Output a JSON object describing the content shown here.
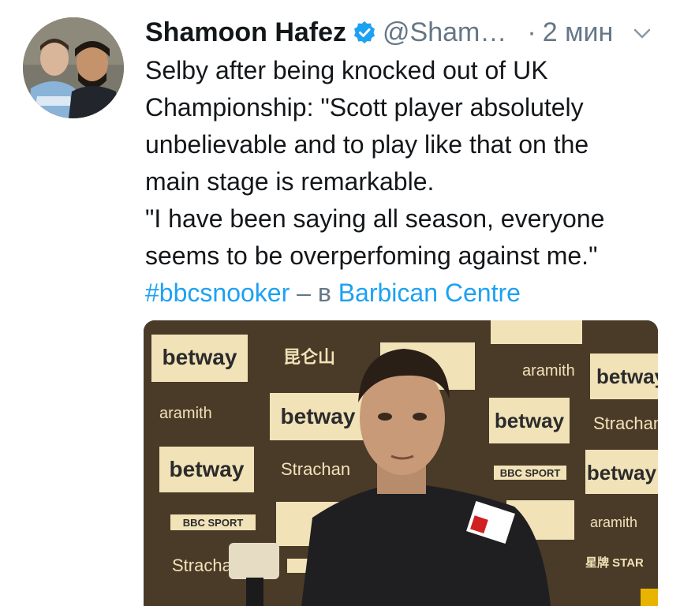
{
  "tweet": {
    "author_name": "Shamoon Hafez",
    "handle": "@Sham…",
    "separator": "·",
    "time": "2 мин",
    "text_lines": [
      "Selby after being knocked out of UK",
      "Championship: \"Scott player absolutely",
      "unbelievable and to play like that on the",
      "main stage is remarkable.",
      "\"I have been saying all season, everyone",
      "seems to be overperfoming against me.\""
    ],
    "hashtag": "#bbcsnooker",
    "location_prefix": "– в",
    "location": "Barbican Centre"
  },
  "icons": {
    "verified": "verified-badge-icon",
    "menu": "chevron-down-icon"
  },
  "colors": {
    "link": "#1da1f2",
    "secondary": "#657786",
    "text": "#14171a",
    "verified": "#1da1f2"
  },
  "media": {
    "board_logos": [
      "betway",
      "昆仑山",
      "aramith",
      "Strachan",
      "BBC SPORT",
      "星牌 STAR"
    ]
  }
}
